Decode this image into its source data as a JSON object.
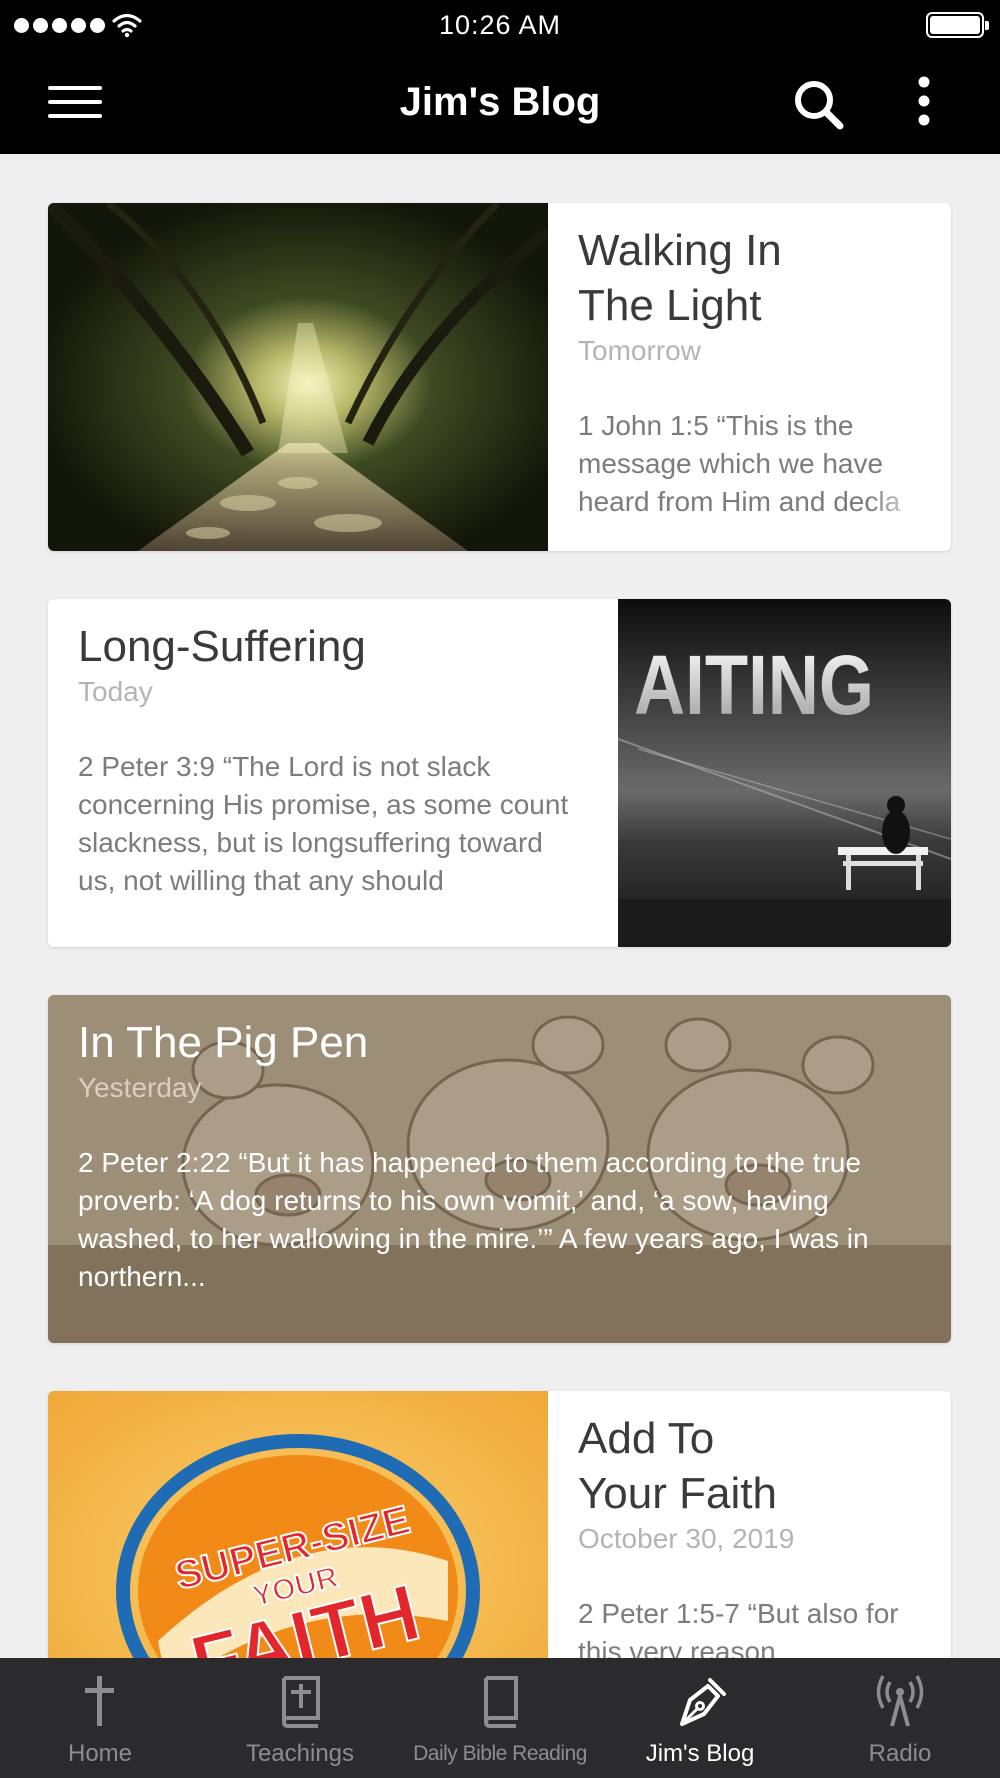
{
  "status_bar": {
    "time": "10:26 AM",
    "signal_icon": "signal-dots-icon",
    "wifi_icon": "wifi-icon",
    "battery_icon": "battery-icon",
    "battery_level": 1.0
  },
  "header": {
    "title": "Jim's Blog",
    "menu_icon": "hamburger-menu-icon",
    "search_icon": "search-icon",
    "more_icon": "more-vertical-icon"
  },
  "posts": [
    {
      "title_line1": "Walking In",
      "title_line2": "The Light",
      "date": "Tomorrow",
      "excerpt": "1 John 1:5 “This is the message which we have heard from Him and decla"
    },
    {
      "title_line1": "Long-Suffering",
      "date": "Today",
      "excerpt": "2 Peter 3:9 “The Lord is not slack concerning His promise, as some count slackness, but is longsuffering toward us, not willing that any should",
      "image_text": "AITING"
    },
    {
      "title_line1": "In The Pig Pen",
      "date": "Yesterday",
      "excerpt": "2 Peter 2:22 “But it has happened to them according to the true proverb: ‘A dog returns to his own vomit,’ and, ‘a sow, having washed, to her wallowing in the mire.’” A few years ago, I was in northern..."
    },
    {
      "title_line1": "Add To",
      "title_line2": "Your Faith",
      "date": "October 30, 2019",
      "excerpt": "2 Peter 1:5-7 “But also for this very reason",
      "image_text_1": "SUPER-SIZE",
      "image_text_2": "YOUR",
      "image_text_3": "FAITH"
    }
  ],
  "tabs": [
    {
      "label": "Home",
      "icon": "cross-icon",
      "active": false
    },
    {
      "label": "Teachings",
      "icon": "bible-plus-icon",
      "active": false
    },
    {
      "label": "Daily Bible Reading",
      "icon": "book-icon",
      "active": false
    },
    {
      "label": "Jim's Blog",
      "icon": "pen-nib-icon",
      "active": true
    },
    {
      "label": "Radio",
      "icon": "radio-tower-icon",
      "active": false
    }
  ],
  "colors": {
    "header_bg": "#000000",
    "tab_bar_bg": "#2b2b2d",
    "tab_inactive": "#8d8d8f",
    "tab_active": "#ffffff",
    "page_bg": "#efefef"
  }
}
